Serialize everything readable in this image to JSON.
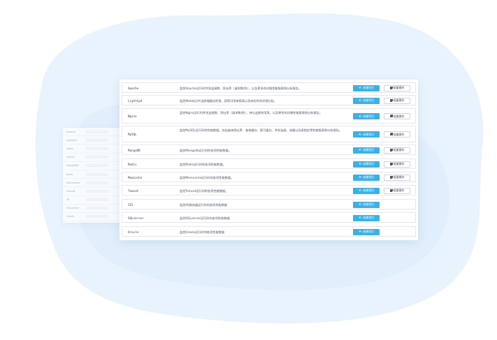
{
  "colors": {
    "accent": "#3db0e6",
    "background_blob": "#e9f3fd",
    "row_border": "#e3e7ee"
  },
  "buttons": {
    "create_label": "创建项目",
    "batch_label": "批量操作"
  },
  "rows": [
    {
      "name": "Apache",
      "description": "监控Apache运行时并发连接数、吞吐率（请求数/秒），以及更多的详细性能报表和分析报告。",
      "has_batch": true
    },
    {
      "name": "Lighttpd",
      "description": "监控Web站点中当前端疑似死锁，获得可用来报表以及响应时间详细分析。",
      "has_batch": true
    },
    {
      "name": "Nginx",
      "description": "监控Nginx运行时并发连接数、吞吐率（请求数/秒），持久连接利用率，以及更多的详细性能报表和分析报告。",
      "has_batch": true
    },
    {
      "name": "MySQL",
      "description": "监控MySQL运行时的性能数据，包括查询吞吐率、查询缓存、索引缓存、并发连接、流量以及表锁定等性能报表和分析报告。",
      "has_batch": true
    },
    {
      "name": "MongoDB",
      "description": "监控Mongodb运行时的各项性能数据。",
      "has_batch": true
    },
    {
      "name": "Redis",
      "description": "监控Redis运行时的各项性能数据。",
      "has_batch": true
    },
    {
      "name": "Memcache",
      "description": "监控Memcache运行时的各项性能数据。",
      "has_batch": true
    },
    {
      "name": "Tomcat",
      "description": "监控Tomcat运行时的各项性能数据。",
      "has_batch": true
    },
    {
      "name": "IIS",
      "description": "监控IIS服务器运行时的各项性能数据",
      "has_batch": false
    },
    {
      "name": "SQLserver",
      "description": "监控SQLserver运行时的各项性能数据",
      "has_batch": false
    },
    {
      "name": "Oracle",
      "description": "监控Oracle运行时的各项性能数据",
      "has_batch": false
    }
  ],
  "ghost_rows": [
    {
      "name": "Apache",
      "description": "░░░░░░░░░░░░"
    },
    {
      "name": "Lighttpd",
      "description": "░░░░░░░░░░░░"
    },
    {
      "name": "Nginx",
      "description": "░░░░░░░░░░░░"
    },
    {
      "name": "MySQL",
      "description": "░░░░░░░░░░░░"
    },
    {
      "name": "MongoDB",
      "description": "░░░░░░░░░░░░"
    },
    {
      "name": "Redis",
      "description": "░░░░░░░░░░░░"
    },
    {
      "name": "Memcache",
      "description": "░░░░░░░░░░░░"
    },
    {
      "name": "Tomcat",
      "description": "░░░░░░░░░░░░"
    },
    {
      "name": "IIS",
      "description": "░░░░░░░░░░░░"
    },
    {
      "name": "SQLserver",
      "description": "░░░░░░░░░░░░"
    },
    {
      "name": "Oracle",
      "description": "░░░░░░░░░░░░"
    }
  ]
}
